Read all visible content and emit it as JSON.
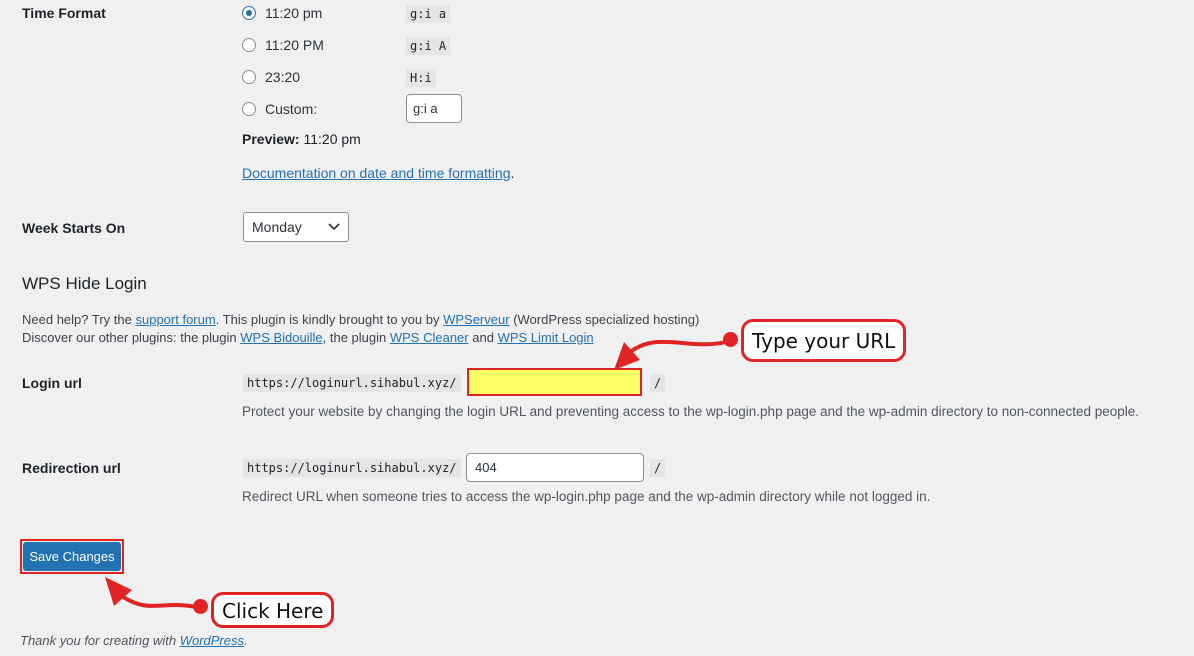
{
  "time_format": {
    "label": "Time Format",
    "options": [
      {
        "label": "11:20 pm",
        "code": "g:i a",
        "checked": true
      },
      {
        "label": "11:20 PM",
        "code": "g:i A",
        "checked": false
      },
      {
        "label": "23:20",
        "code": "H:i",
        "checked": false
      },
      {
        "label": "Custom:",
        "custom_value": "g:i a",
        "checked": false
      }
    ],
    "preview_label": "Preview:",
    "preview_value": "11:20 pm",
    "doc_link": "Documentation on date and time formatting",
    "doc_suffix": "."
  },
  "week_starts": {
    "label": "Week Starts On",
    "selected": "Monday"
  },
  "wps": {
    "title": "WPS Hide Login",
    "help_prefix": "Need help? Try the",
    "help_link": "support forum",
    "help_mid": ". This plugin is kindly brought to you by",
    "host_link": "WPServeur",
    "help_suffix": "(WordPress specialized hosting)",
    "discover_prefix": "Discover our other plugins: the plugin",
    "plugin1": "WPS Bidouille",
    "discover_mid1": ", the plugin",
    "plugin2": "WPS Cleaner",
    "discover_mid2": "and",
    "plugin3": "WPS Limit Login",
    "login": {
      "label": "Login url",
      "prefix": "https://loginurl.sihabul.xyz/",
      "value": "",
      "suffix": "/",
      "description": "Protect your website by changing the login URL and preventing access to the wp-login.php page and the wp-admin directory to non-connected people."
    },
    "redirect": {
      "label": "Redirection url",
      "prefix": "https://loginurl.sihabul.xyz/",
      "value": "404",
      "suffix": "/",
      "description": "Redirect URL when someone tries to access the wp-login.php page and the wp-admin directory while not logged in."
    }
  },
  "save_button": "Save Changes",
  "callouts": {
    "type_url": "Type your URL",
    "click_here": "Click Here"
  },
  "footer": {
    "prefix": "Thank you for creating with",
    "link": "WordPress",
    "suffix": "."
  },
  "colors": {
    "accent": "#2271b1",
    "annotation_red": "#e02424",
    "highlight_yellow": "#ffff66"
  }
}
